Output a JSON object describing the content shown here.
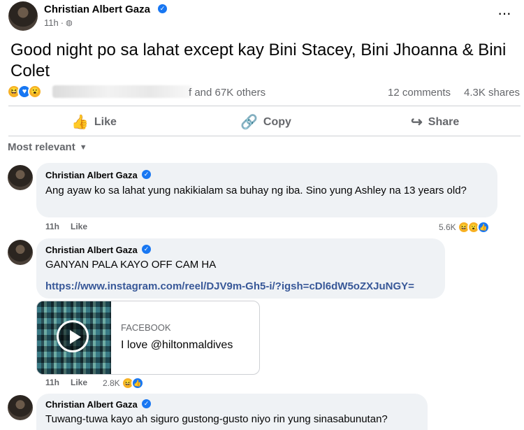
{
  "post": {
    "author": "Christian Albert Gaza",
    "time": "11h",
    "text": "Good night po sa lahat except kay Bini Stacey, Bini Jhoanna & Bini Colet",
    "reactions_tail": "f and 67K others",
    "comments_count": "12 comments",
    "shares_count": "4.3K shares"
  },
  "actions": {
    "like": "Like",
    "copy": "Copy",
    "share": "Share"
  },
  "sort": {
    "label": "Most relevant"
  },
  "comments": [
    {
      "author": "Christian Albert Gaza",
      "text": "Ang ayaw ko sa lahat yung nakikialam sa buhay ng iba. Sino yung Ashley na 13 years old?",
      "time": "11h",
      "like": "Like",
      "reactions": "5.6K"
    },
    {
      "author": "Christian Albert Gaza",
      "text": "GANYAN PALA KAYO OFF CAM HA",
      "link": "https://www.instagram.com/reel/DJV9m-Gh5-i/?igsh=cDl6dW5oZXJuNGY=",
      "card_source": "FACEBOOK",
      "card_title": "I love @hiltonmaldives",
      "time": "11h",
      "like": "Like",
      "reactions": "2.8K"
    },
    {
      "author": "Christian Albert Gaza",
      "text": "Tuwang-tuwa kayo ah siguro gustong-gusto niyo rin yung sinasabunutan?"
    }
  ]
}
